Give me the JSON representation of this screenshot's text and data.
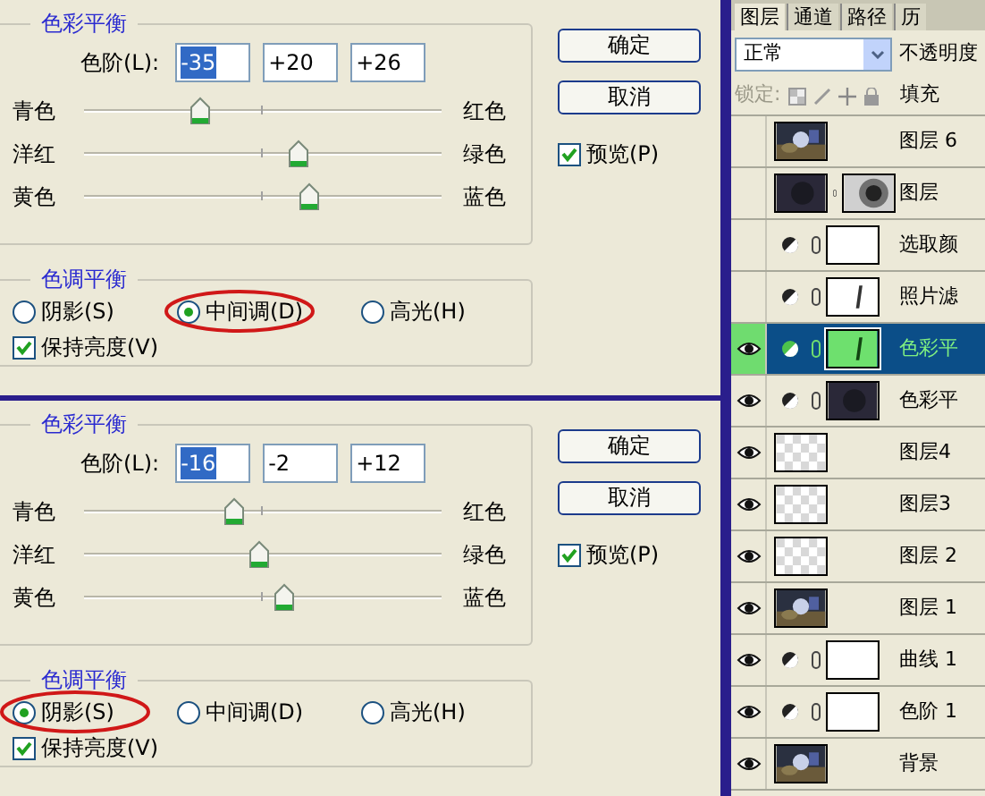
{
  "dialogs": [
    {
      "color_balance": {
        "title": "色彩平衡",
        "levels_label": "色阶(L):",
        "fields": [
          {
            "value": "-35",
            "highlighted": true
          },
          {
            "value": "+20",
            "highlighted": false
          },
          {
            "value": "+26",
            "highlighted": false
          }
        ],
        "sliders": [
          {
            "left": "青色",
            "right": "红色",
            "level": 0.325
          },
          {
            "left": "洋红",
            "right": "绿色",
            "level": 0.6
          },
          {
            "left": "黄色",
            "right": "蓝色",
            "level": 0.63
          }
        ]
      },
      "tone_balance": {
        "title": "色调平衡",
        "options": [
          {
            "label": "阴影(S)",
            "selected": false,
            "circled": false
          },
          {
            "label": "中间调(D)",
            "selected": true,
            "circled": true
          },
          {
            "label": "高光(H)",
            "selected": false,
            "circled": false
          }
        ],
        "preserve": {
          "label": "保持亮度(V)",
          "checked": true
        }
      },
      "buttons": [
        "确定",
        "取消"
      ],
      "preview": {
        "label": "预览(P)",
        "checked": true
      }
    },
    {
      "color_balance": {
        "title": "色彩平衡",
        "levels_label": "色阶(L):",
        "fields": [
          {
            "value": "-16",
            "highlighted": true
          },
          {
            "value": "-2",
            "highlighted": false
          },
          {
            "value": "+12",
            "highlighted": false
          }
        ],
        "sliders": [
          {
            "left": "青色",
            "right": "红色",
            "level": 0.42
          },
          {
            "left": "洋红",
            "right": "绿色",
            "level": 0.49
          },
          {
            "left": "黄色",
            "right": "蓝色",
            "level": 0.56
          }
        ]
      },
      "tone_balance": {
        "title": "色调平衡",
        "options": [
          {
            "label": "阴影(S)",
            "selected": true,
            "circled": true
          },
          {
            "label": "中间调(D)",
            "selected": false,
            "circled": false
          },
          {
            "label": "高光(H)",
            "selected": false,
            "circled": false
          }
        ],
        "preserve": {
          "label": "保持亮度(V)",
          "checked": true
        }
      },
      "buttons": [
        "确定",
        "取消"
      ],
      "preview": {
        "label": "预览(P)",
        "checked": true
      }
    }
  ],
  "layers_panel": {
    "tabs": [
      {
        "label": "图层",
        "selected": true
      },
      {
        "label": "通道",
        "selected": false
      },
      {
        "label": "路径",
        "selected": false
      },
      {
        "label": "历",
        "selected": false
      }
    ],
    "blend_mode": "正常",
    "opacity_label": "不透明度",
    "lock_label": "锁定:",
    "fill_label": "填充",
    "layers": [
      {
        "name": "图层 6",
        "visible": false,
        "selected": false
      },
      {
        "name": "图层",
        "visible": false,
        "selected": false,
        "kind": "masked",
        "thumb": {
          "kind": "dark"
        },
        "mask": {
          "kind": "gradient"
        }
      },
      {
        "name": "选取颜",
        "visible": false,
        "selected": false,
        "kind": "adjustment",
        "mask": {
          "kind": "white"
        }
      },
      {
        "name": "照片滤",
        "visible": false,
        "selected": false,
        "kind": "adjustment",
        "mask": {
          "kind": "stroke"
        }
      },
      {
        "name": "色彩平",
        "visible": true,
        "selected": true,
        "kind": "adjustment",
        "mask": {
          "kind": "green"
        }
      },
      {
        "name": "色彩平",
        "visible": true,
        "selected": false,
        "kind": "adjustment",
        "mask": {
          "kind": "dark"
        }
      },
      {
        "name": "图层4",
        "visible": true,
        "selected": false,
        "thumb": {
          "kind": "transparent"
        }
      },
      {
        "name": "图层3",
        "visible": true,
        "selected": false,
        "thumb": {
          "kind": "transparent"
        }
      },
      {
        "name": "图层 2",
        "visible": true,
        "selected": false,
        "thumb": {
          "kind": "transparent"
        }
      },
      {
        "name": "图层 1",
        "visible": true,
        "selected": false
      },
      {
        "name": "曲线 1",
        "visible": true,
        "selected": false,
        "kind": "adjustment",
        "mask": {
          "kind": "white"
        }
      },
      {
        "name": "色阶 1",
        "visible": true,
        "selected": false,
        "kind": "adjustment",
        "mask": {
          "kind": "white"
        }
      },
      {
        "name": "背景",
        "visible": true,
        "selected": false
      }
    ]
  }
}
